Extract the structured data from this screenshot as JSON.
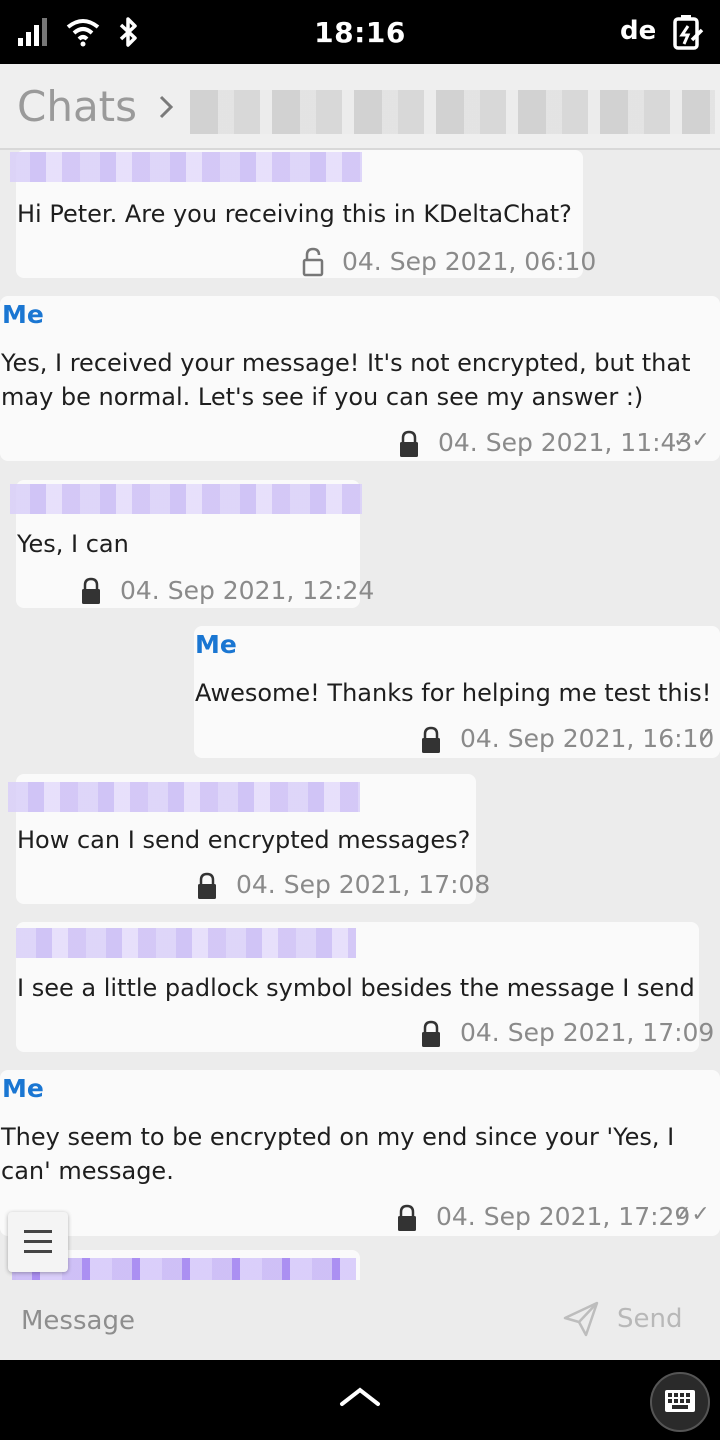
{
  "status_bar": {
    "time": "18:16",
    "keyboard_layout": "de",
    "icons": [
      "signal-icon",
      "wifi-icon",
      "bluetooth-icon",
      "battery-charging-icon"
    ]
  },
  "header": {
    "breadcrumb_root": "Chats",
    "chat_name_redacted": true
  },
  "messages": [
    {
      "from_me": false,
      "sender": "",
      "text": "Hi Peter. Are you receiving this in KDeltaChat?",
      "timestamp": "04. Sep 2021, 06:10",
      "encrypted": false,
      "checks": ""
    },
    {
      "from_me": true,
      "sender": "Me",
      "text": "Yes, I received your message! It's not encrypted, but that\nmay be normal. Let's see if you can see my answer :)",
      "timestamp": "04. Sep 2021, 11:43",
      "encrypted": true,
      "checks": "✓✓"
    },
    {
      "from_me": false,
      "sender": "",
      "text": "Yes, I can",
      "timestamp": "04. Sep 2021, 12:24",
      "encrypted": true,
      "checks": ""
    },
    {
      "from_me": true,
      "sender": "Me",
      "text": "Awesome! Thanks for helping me test this!",
      "timestamp": "04. Sep 2021, 16:10",
      "encrypted": true,
      "checks": "✓"
    },
    {
      "from_me": false,
      "sender": "",
      "text": "How can I send encrypted messages?",
      "timestamp": "04. Sep 2021, 17:08",
      "encrypted": true,
      "checks": ""
    },
    {
      "from_me": false,
      "sender": "",
      "text": "I see a little padlock symbol besides the message I send",
      "timestamp": "04. Sep 2021, 17:09",
      "encrypted": true,
      "checks": ""
    },
    {
      "from_me": true,
      "sender": "Me",
      "text": "They seem to be encrypted on my end since your 'Yes, I\ncan' message.",
      "timestamp": "04. Sep 2021, 17:29",
      "encrypted": true,
      "checks": "✓✓"
    }
  ],
  "composer": {
    "placeholder": "Message",
    "send_label": "Send"
  },
  "colors": {
    "me_sender": "#1a76d2",
    "timestamp": "#8a8a8a",
    "bubble": "#fafafa",
    "background": "#ececec"
  }
}
